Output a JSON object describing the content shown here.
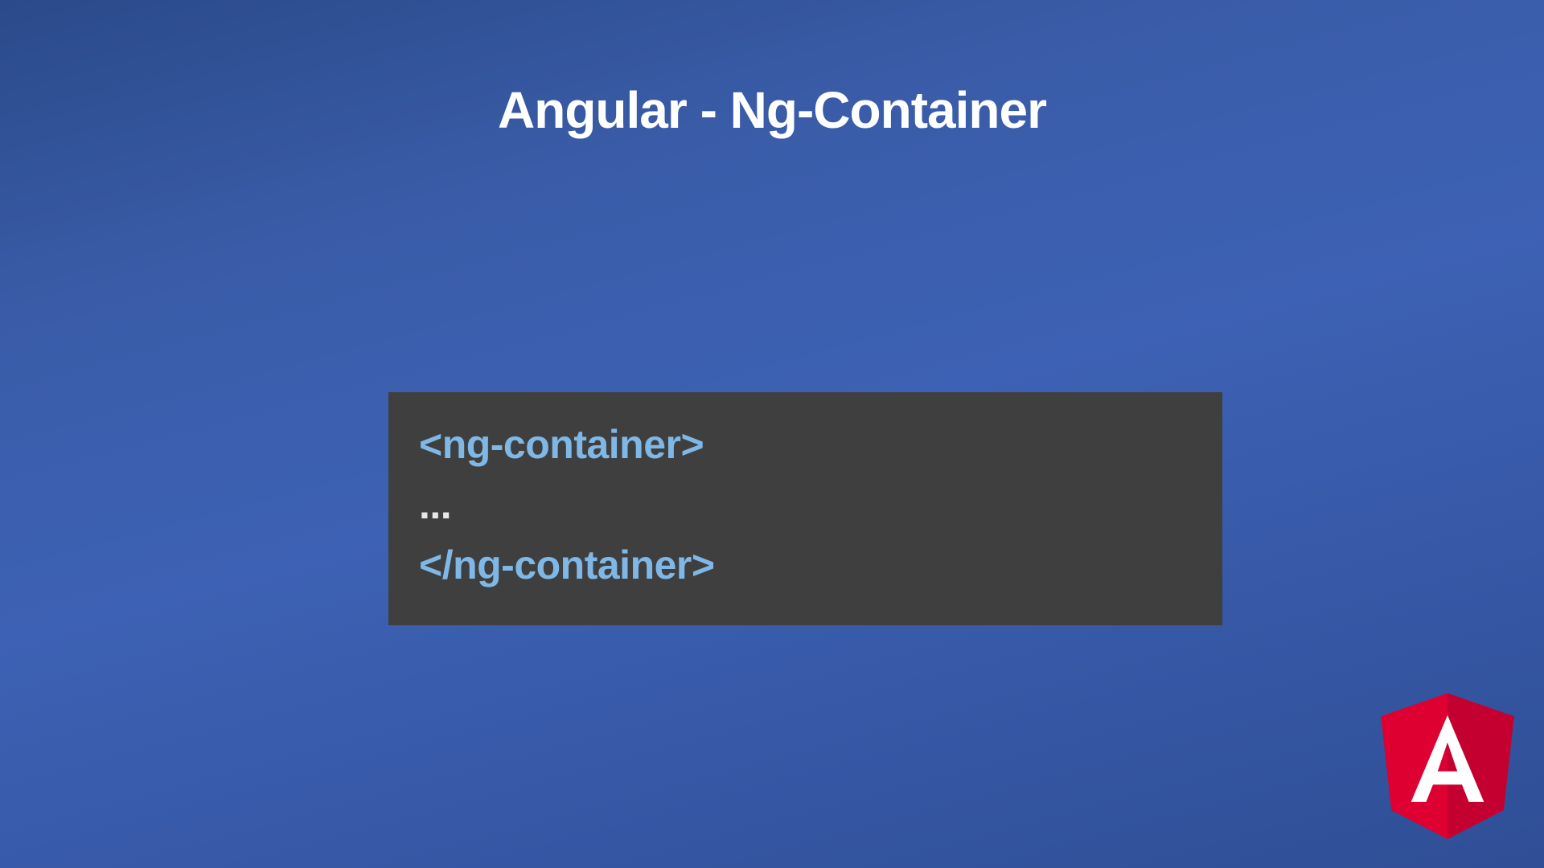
{
  "title": "Angular - Ng-Container",
  "code": {
    "line1": "<ng-container>",
    "line2": "...",
    "line3": "</ng-container>"
  },
  "logo_name": "angular-logo-icon"
}
